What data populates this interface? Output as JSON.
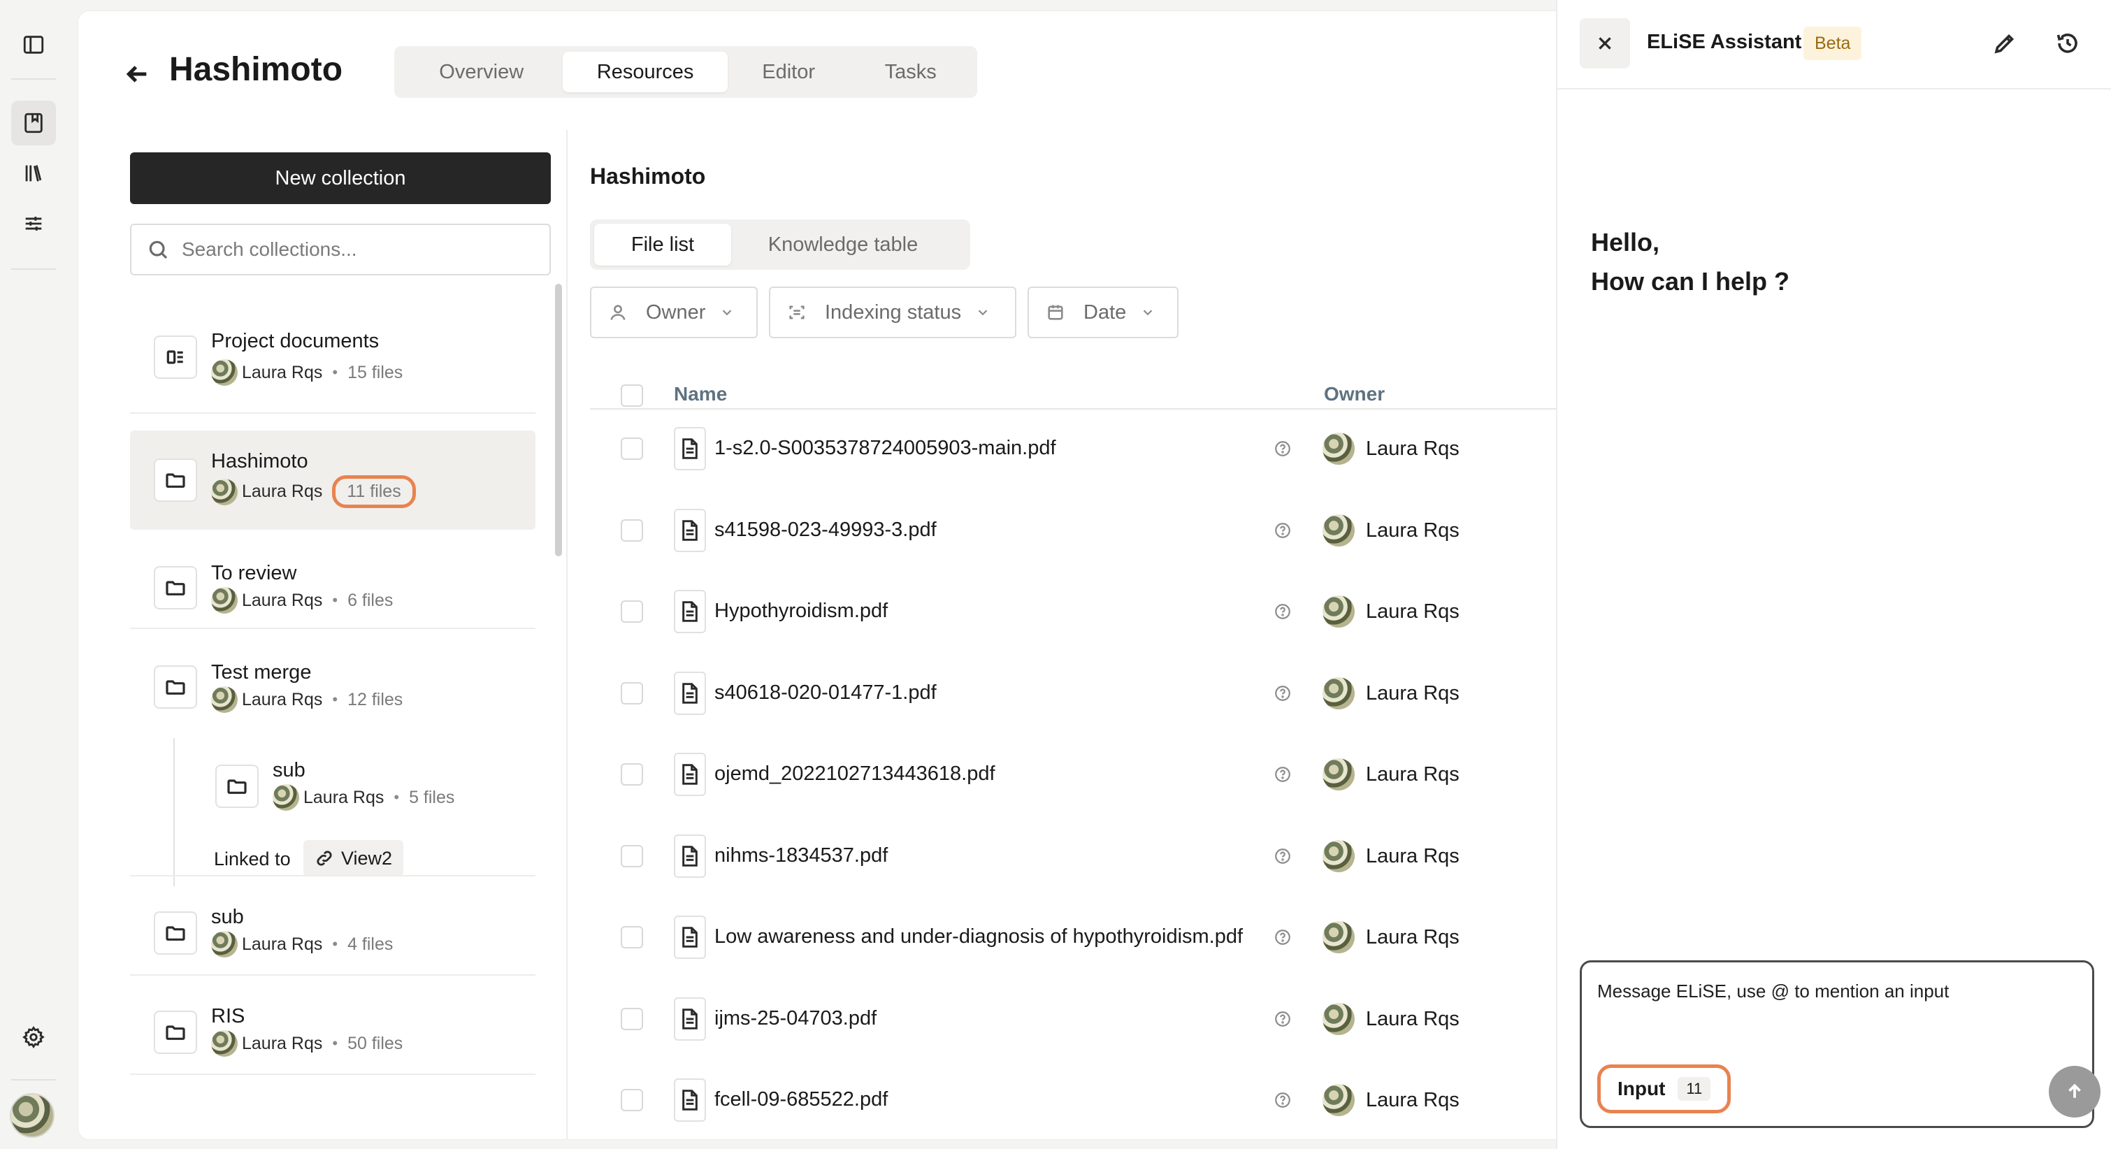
{
  "rail": {
    "items": [
      {
        "icon": "sidebar-toggle-icon"
      },
      {
        "icon": "bookmark-icon",
        "active": true
      },
      {
        "icon": "library-icon"
      },
      {
        "icon": "sliders-icon"
      },
      {
        "icon": "gear-icon"
      }
    ]
  },
  "header": {
    "title": "Hashimoto",
    "tabs": [
      {
        "label": "Overview"
      },
      {
        "label": "Resources",
        "active": true
      },
      {
        "label": "Editor"
      },
      {
        "label": "Tasks"
      }
    ]
  },
  "collections": {
    "new_button": "New collection",
    "search_placeholder": "Search collections...",
    "items": [
      {
        "name": "Project documents",
        "owner": "Laura Rqs",
        "files": "15 files",
        "icon": "dashboard-icon"
      },
      {
        "name": "Hashimoto",
        "owner": "Laura Rqs",
        "files": "11 files",
        "icon": "folder-icon",
        "selected": true
      },
      {
        "name": "To review",
        "owner": "Laura Rqs",
        "files": "6 files",
        "icon": "folder-icon"
      },
      {
        "name": "Test merge",
        "owner": "Laura Rqs",
        "files": "12 files",
        "icon": "folder-icon"
      },
      {
        "name": "sub",
        "owner": "Laura Rqs",
        "files": "5 files",
        "icon": "folder-icon"
      },
      {
        "name": "sub",
        "owner": "Laura Rqs",
        "files": "4 files",
        "icon": "folder-icon"
      },
      {
        "name": "RIS",
        "owner": "Laura Rqs",
        "files": "50 files",
        "icon": "folder-icon"
      }
    ],
    "linked_label": "Linked to",
    "linked_target": "View2",
    "separator": "•"
  },
  "files": {
    "title": "Hashimoto",
    "tabs": [
      {
        "label": "File list",
        "active": true
      },
      {
        "label": "Knowledge table"
      }
    ],
    "filters": [
      {
        "label": "Owner",
        "icon": "user-icon"
      },
      {
        "label": "Indexing status",
        "icon": "scan-icon"
      },
      {
        "label": "Date",
        "icon": "calendar-icon"
      }
    ],
    "columns": {
      "name": "Name",
      "owner": "Owner"
    },
    "rows": [
      {
        "name": "1-s2.0-S0035378724005903-main.pdf",
        "owner": "Laura Rqs"
      },
      {
        "name": "s41598-023-49993-3.pdf",
        "owner": "Laura Rqs"
      },
      {
        "name": "Hypothyroidism.pdf",
        "owner": "Laura Rqs"
      },
      {
        "name": "s40618-020-01477-1.pdf",
        "owner": "Laura Rqs"
      },
      {
        "name": "ojemd_2022102713443618.pdf",
        "owner": "Laura Rqs"
      },
      {
        "name": "nihms-1834537.pdf",
        "owner": "Laura Rqs"
      },
      {
        "name": "Low awareness and under-diagnosis of hypothyroidism.pdf",
        "owner": "Laura Rqs"
      },
      {
        "name": "ijms-25-04703.pdf",
        "owner": "Laura Rqs"
      },
      {
        "name": "fcell-09-685522.pdf",
        "owner": "Laura Rqs"
      }
    ]
  },
  "assistant": {
    "title": "ELiSE Assistant",
    "badge": "Beta",
    "greeting_line1": "Hello,",
    "greeting_line2": "How can I help ?",
    "composer_placeholder": "Message ELiSE, use @ to mention an input",
    "input_label": "Input",
    "input_count": "11"
  },
  "colors": {
    "accent_highlight": "#e8834f",
    "primary_button": "#262626",
    "beta_badge_bg": "#fdf3dc",
    "beta_badge_text": "#9a6a12"
  }
}
